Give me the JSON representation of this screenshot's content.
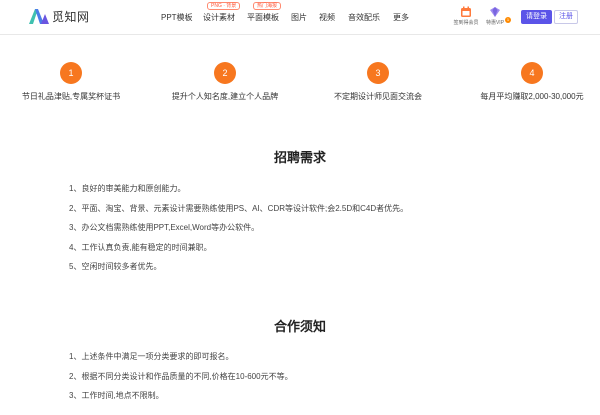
{
  "header": {
    "logo_text": "觅知网",
    "nav": [
      {
        "label": "PPT模板",
        "tag": ""
      },
      {
        "label": "设计素材",
        "tag": "PNG · 背景"
      },
      {
        "label": "平面模板",
        "tag": "热门海报"
      },
      {
        "label": "图片",
        "tag": ""
      },
      {
        "label": "视频",
        "tag": ""
      },
      {
        "label": "音效配乐",
        "tag": ""
      },
      {
        "label": "更多",
        "tag": ""
      }
    ],
    "icons": [
      {
        "label": "签到得会员",
        "icon": "calendar-icon"
      },
      {
        "label": "特惠VIP",
        "icon": "vip-icon"
      }
    ],
    "vip_badge": "1",
    "login_label": "请登录",
    "register_label": "注册"
  },
  "benefits": [
    {
      "num": "1",
      "text": "节日礼品津贴,专属奖杯证书"
    },
    {
      "num": "2",
      "text": "提升个人知名度,建立个人品牌"
    },
    {
      "num": "3",
      "text": "不定期设计师见面交流会"
    },
    {
      "num": "4",
      "text": "每月平均赚取2,000-30,000元"
    }
  ],
  "requirements": {
    "title": "招聘需求",
    "items": [
      "1、良好的审美能力和原创能力。",
      "2、平面、淘宝、背景、元素设计需要熟练使用PS、AI、CDR等设计软件;会2.5D和C4D者优先。",
      "3、办公文档需熟练使用PPT,Excel,Word等办公软件。",
      "4、工作认真负责,能有稳定的时间兼职。",
      "5、空闲时间较多者优先。"
    ]
  },
  "cooperation": {
    "title": "合作须知",
    "items": [
      "1、上述条件中满足一项分类要求的即可报名。",
      "2、根据不同分类设计和作品质量的不同,价格在10-600元不等。",
      "3、工作时间,地点不限制。"
    ]
  },
  "colors": {
    "accent": "#f7771f",
    "brand": "#5b54e8"
  }
}
